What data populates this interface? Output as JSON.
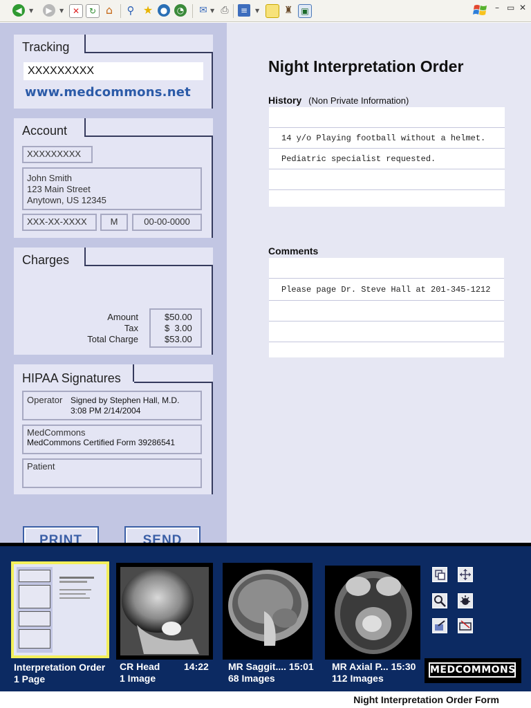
{
  "browser": {
    "toolbar_icons": [
      "back-icon",
      "forward-icon",
      "stop-icon",
      "refresh-icon",
      "home-icon",
      "search-icon",
      "favorites-icon",
      "media-icon",
      "history-icon",
      "mail-icon",
      "print-icon",
      "edit-icon",
      "discuss-icon",
      "messenger-icon",
      "window-icon"
    ],
    "window_controls": [
      "–",
      "▭",
      "✕"
    ]
  },
  "tracking": {
    "title": "Tracking",
    "number": "XXXXXXXXX",
    "url": "www.medcommons.net"
  },
  "account": {
    "title": "Account",
    "id": "XXXXXXXXX",
    "address_lines": [
      "John Smith",
      "123 Main Street",
      "Anytown, US 12345"
    ],
    "ssn": "XXX-XX-XXXX",
    "sex": "M",
    "dob": "00-00-0000"
  },
  "charges": {
    "title": "Charges",
    "amount_label": "Amount",
    "amount_value": "$50.00",
    "tax_label": "Tax",
    "tax_value": "$  3.00",
    "total_label": "Total Charge",
    "total_value": "$53.00"
  },
  "hipaa": {
    "title": "HIPAA Signatures",
    "operator_label": "Operator",
    "operator_sig": "Signed by Stephen Hall, M.D.",
    "operator_time": "3:08 PM 2/14/2004",
    "medcommons_label": "MedCommons",
    "medcommons_sig": "MedCommons Certified Form 39286541",
    "patient_label": "Patient"
  },
  "buttons": {
    "print": "PRINT",
    "send": "SEND"
  },
  "order": {
    "title": "Night Interpretation Order",
    "history_label": "History",
    "history_note": "(Non Private Information)",
    "history_lines": [
      "",
      "14 y/o Playing football without a helmet.",
      "Pediatric specialist requested.",
      "",
      ""
    ],
    "comments_label": "Comments",
    "comment_lines": [
      "",
      "Please page Dr. Steve Hall at 201-345-1212",
      "",
      "",
      ""
    ]
  },
  "thumbnails": [
    {
      "title": "Interpretation Order",
      "time": "",
      "subtitle": "1 Page"
    },
    {
      "title": "CR Head",
      "time": "14:22",
      "subtitle": "1 Image"
    },
    {
      "title": "MR Saggit....",
      "time": "15:01",
      "subtitle": "68 Images"
    },
    {
      "title": "MR Axial P...",
      "time": "15:30",
      "subtitle": "112 Images"
    }
  ],
  "logo": "MEDCOMMONS",
  "footer": "Night Interpretation Order Form",
  "colors": {
    "panel": "#c2c6e3",
    "card": "#e4e5f4",
    "accent": "#3b5fa6",
    "strip": "#0c2a62",
    "selection": "#f3ef5a"
  }
}
